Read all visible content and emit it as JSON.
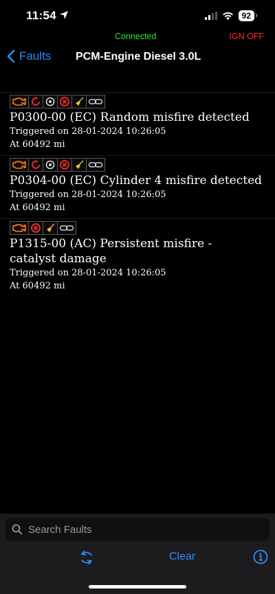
{
  "status_bar": {
    "time": "11:54",
    "battery": "92"
  },
  "connection": {
    "status": "Connected",
    "ignition": "IGN OFF",
    "status_color": "#2ee62e",
    "ignition_color": "#ff2a2a"
  },
  "nav": {
    "back_label": "Faults",
    "title": "PCM-Engine Diesel 3.0L"
  },
  "faults": [
    {
      "code": "P0300-00 (EC) Random misfire detected",
      "triggered": "Triggered on 28-01-2024 10:26:05",
      "mileage": "At 60492 mi",
      "icons": [
        "engine-warning-icon",
        "pending-icon",
        "confirmed-icon",
        "active-icon",
        "clearable-icon",
        "linked-icon"
      ]
    },
    {
      "code": "P0304-00 (EC) Cylinder 4 misfire detected",
      "triggered": "Triggered on 28-01-2024 10:26:05",
      "mileage": "At 60492 mi",
      "icons": [
        "engine-warning-icon",
        "pending-icon",
        "confirmed-icon",
        "active-icon",
        "clearable-icon",
        "linked-icon"
      ]
    },
    {
      "code_line1": "P1315-00 (AC) Persistent misfire -",
      "code_line2": "catalyst damage",
      "triggered": "Triggered on 28-01-2024 10:26:05",
      "mileage": "At 60492 mi",
      "icons": [
        "engine-warning-icon",
        "active-icon",
        "clearable-icon",
        "linked-icon"
      ]
    }
  ],
  "search": {
    "placeholder": "Search Faults",
    "value": ""
  },
  "toolbar": {
    "clear_label": "Clear"
  },
  "colors": {
    "accent": "#2f8cff",
    "background": "#000000",
    "panel": "#1c1c1e"
  }
}
